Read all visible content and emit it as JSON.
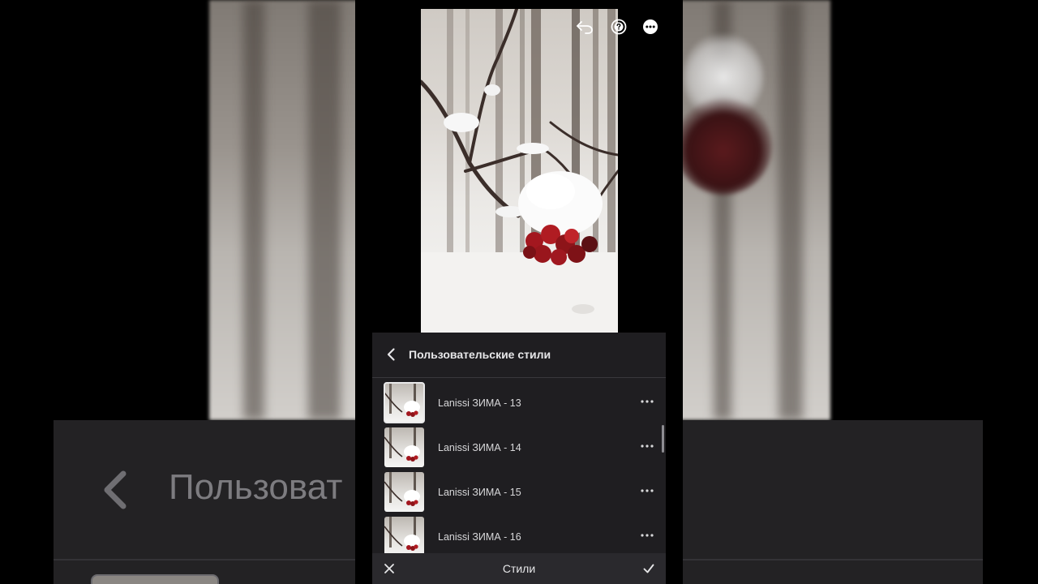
{
  "background_ghost": {
    "title": "Пользоват"
  },
  "toolbar": {
    "undo_icon": "undo-icon",
    "help_icon": "help-icon",
    "more_icon": "more-icon"
  },
  "styles_panel": {
    "title": "Пользовательские стили",
    "back_icon": "chevron-left-icon",
    "items": [
      {
        "label": "Lanissi ЗИМА - 13",
        "selected": true
      },
      {
        "label": "Lanissi ЗИМА - 14",
        "selected": false
      },
      {
        "label": "Lanissi ЗИМА - 15",
        "selected": false
      },
      {
        "label": "Lanissi ЗИМА - 16",
        "selected": false
      }
    ]
  },
  "bottom_bar": {
    "title": "Стили",
    "cancel_icon": "close-icon",
    "apply_icon": "checkmark-icon"
  },
  "colors": {
    "panel_bg": "#1f1e21",
    "bottom_bar_bg": "#2a292d",
    "berry_red": "#a3171f"
  }
}
